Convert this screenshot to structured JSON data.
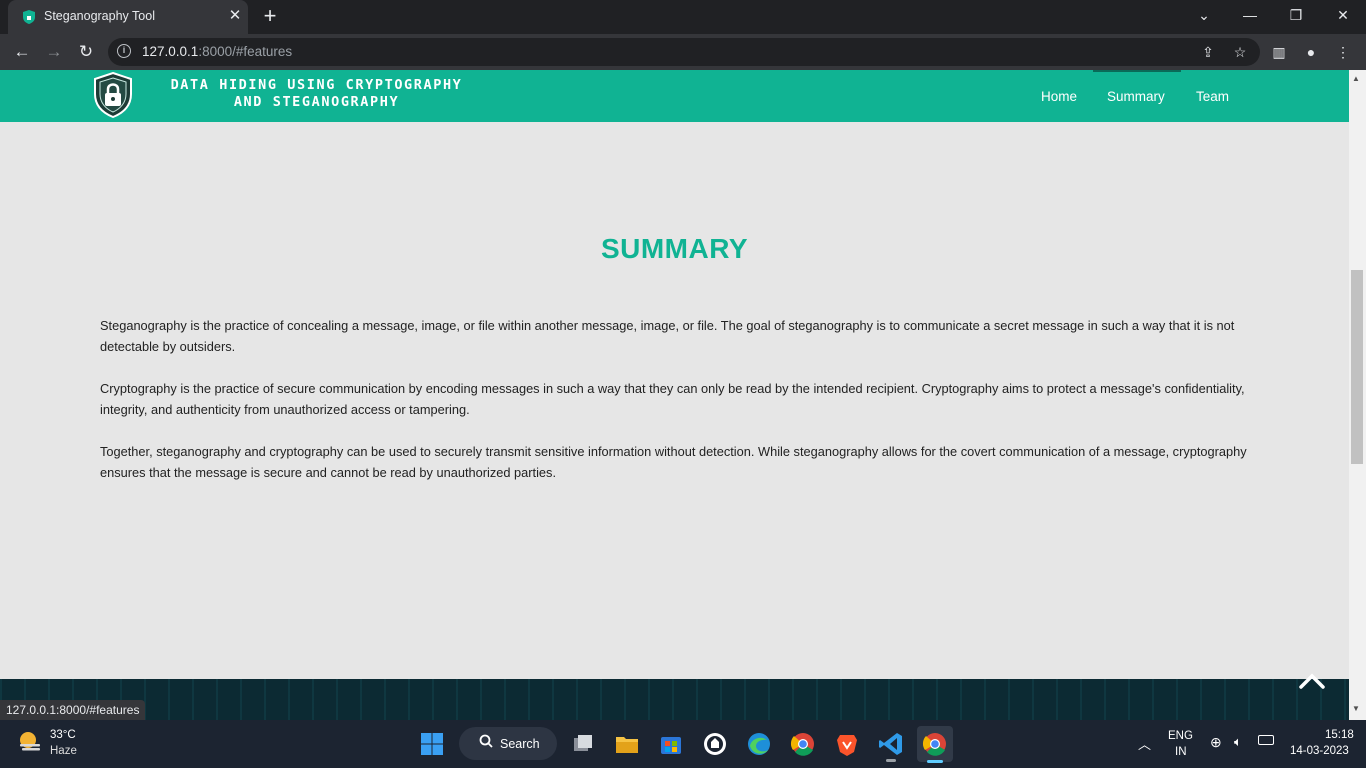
{
  "browser": {
    "tab_title": "Steganography Tool",
    "tab_close": "✕",
    "new_tab": "+",
    "url_host": "127.0.0.1",
    "url_rest": ":8000/#features",
    "status_url": "127.0.0.1:8000/#features"
  },
  "site": {
    "brand_line1": "DATA HIDING USING CRYPTOGRAPHY",
    "brand_line2": "AND STEGANOGRAPHY",
    "nav": [
      "Home",
      "Summary",
      "Team"
    ],
    "active_nav": "Summary",
    "accent_color": "#10b393"
  },
  "summary": {
    "title": "SUMMARY",
    "paragraphs": [
      "Steganography is the practice of concealing a message, image, or file within another message, image, or file. The goal of steganography is to communicate a secret message in such a way that it is not detectable by outsiders.",
      "Cryptography is the practice of secure communication by encoding messages in such a way that they can only be read by the intended recipient. Cryptography aims to protect a message's confidentiality, integrity, and authenticity from unauthorized access or tampering.",
      "Together, steganography and cryptography can be used to securely transmit sensitive information without detection. While steganography allows for the covert communication of a message, cryptography ensures that the message is secure and cannot be read by unauthorized parties."
    ]
  },
  "taskbar": {
    "weather_temp": "33°C",
    "weather_desc": "Haze",
    "search_label": "Search",
    "lang_line1": "ENG",
    "lang_line2": "IN",
    "time": "15:18",
    "date": "14-03-2023"
  }
}
